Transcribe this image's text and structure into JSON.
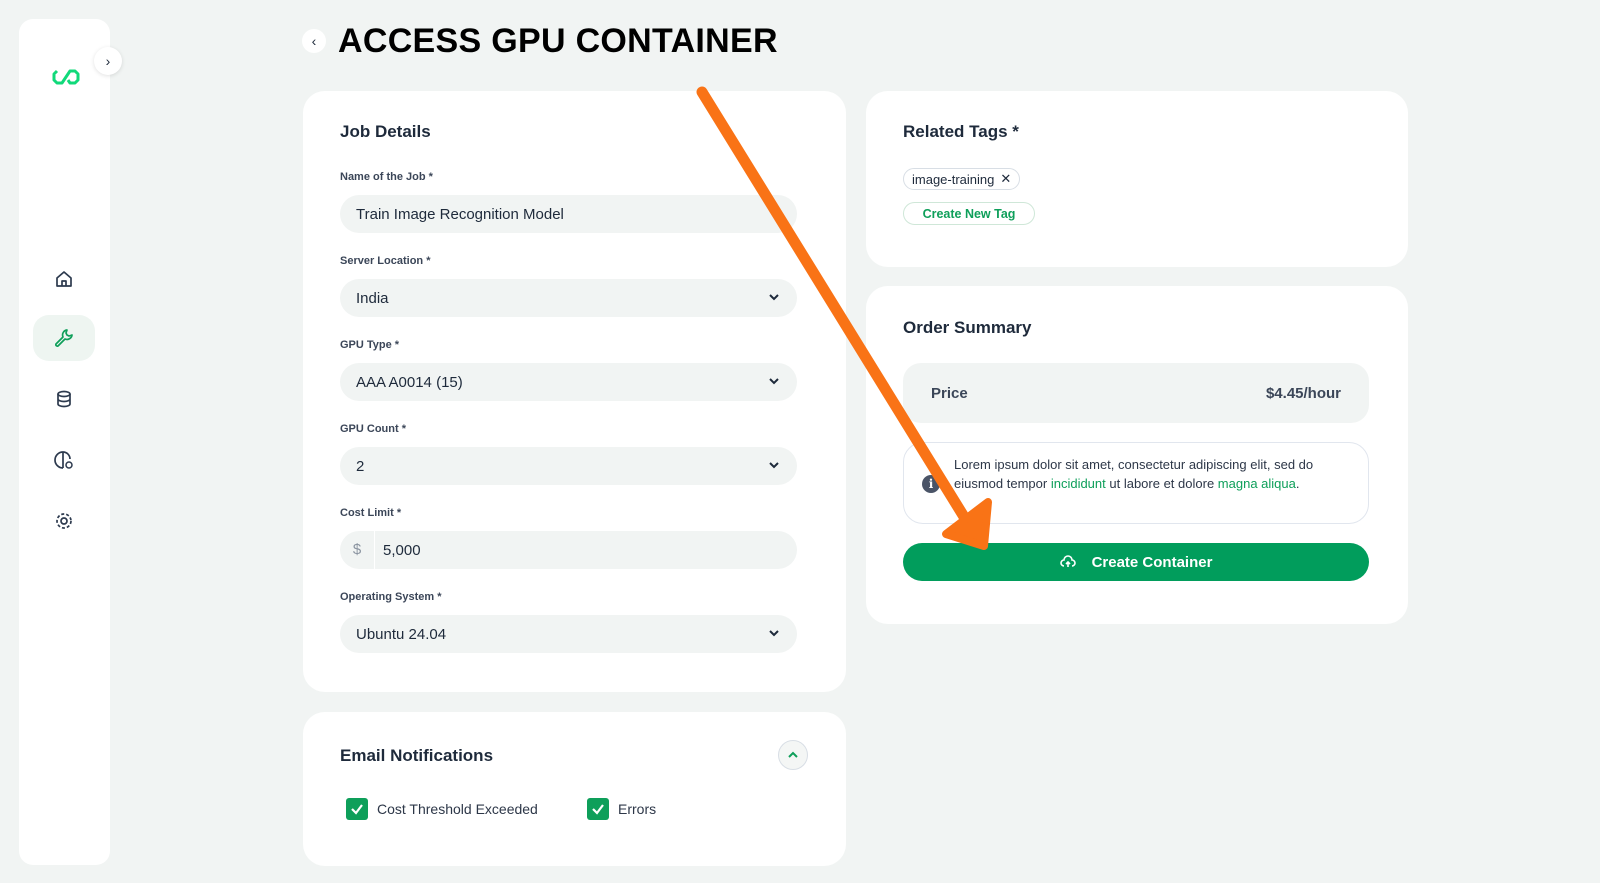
{
  "page": {
    "title": "ACCESS GPU CONTAINER"
  },
  "sidebar": {
    "items": [
      {
        "icon": "home-icon"
      },
      {
        "icon": "wrench-icon",
        "active": true
      },
      {
        "icon": "database-icon"
      },
      {
        "icon": "brain-gear-icon"
      },
      {
        "icon": "settings-icon"
      }
    ]
  },
  "job_details": {
    "title": "Job Details",
    "fields": [
      {
        "label": "Name of the Job *",
        "value": "Train Image Recognition Model"
      },
      {
        "label": "Server Location *",
        "value": "India"
      },
      {
        "label": "GPU Type *",
        "value": "AAA A0014 (15)"
      },
      {
        "label": "GPU Count *",
        "value": "2"
      },
      {
        "label": "Cost Limit *",
        "prefix": "$",
        "value": "5,000"
      },
      {
        "label": "Operating System *",
        "value": "Ubuntu 24.04"
      }
    ]
  },
  "tags": {
    "title": "Related Tags *",
    "items": [
      "image-training"
    ],
    "create_label": "Create New Tag"
  },
  "order": {
    "title": "Order Summary",
    "price_label": "Price",
    "price_value": "$4.45/hour",
    "info_1": "Lorem ipsum dolor sit amet, consectetur adipiscing elit, sed do eiusmod tempor ",
    "info_link1": "incididunt",
    "info_2": " ut labore et dolore ",
    "info_link2": "magna aliqua",
    "info_3": ".",
    "button": "Create Container"
  },
  "email": {
    "title": "Email Notifications",
    "options": [
      {
        "label": "Cost Threshold Exceeded",
        "checked": true
      },
      {
        "label": "Errors",
        "checked": true
      }
    ]
  },
  "colors": {
    "accent": "#019d5c",
    "annotation_arrow": "#f97316"
  }
}
